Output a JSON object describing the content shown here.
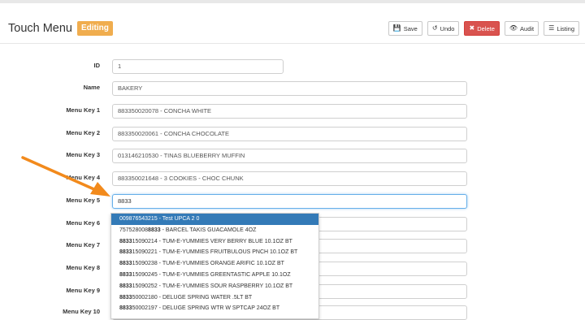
{
  "header": {
    "title": "Touch Menu",
    "badge": "Editing",
    "badge_color": "#f0ad4e"
  },
  "toolbar": {
    "save_label": "Save",
    "undo_label": "Undo",
    "delete_label": "Delete",
    "audit_label": "Audit",
    "listing_label": "Listing",
    "delete_color": "#d9534f",
    "icons": {
      "save": "floppy-icon",
      "undo": "undo-icon",
      "delete": "x-icon",
      "audit": "eye-icon",
      "listing": "list-icon"
    }
  },
  "form": {
    "id_label": "ID",
    "id_value": "1",
    "name_label": "Name",
    "name_value": "BAKERY",
    "menu_keys": [
      {
        "label": "Menu Key 1",
        "value": "883350020078 - CONCHA WHITE"
      },
      {
        "label": "Menu Key 2",
        "value": "883350020061 - CONCHA CHOCOLATE"
      },
      {
        "label": "Menu Key 3",
        "value": "013146210530 - TINAS BLUEBERRY MUFFIN"
      },
      {
        "label": "Menu Key 4",
        "value": "883350021648 - 3 COOKIES - CHOC CHUNK"
      },
      {
        "label": "Menu Key 5",
        "value": "8833"
      },
      {
        "label": "Menu Key 6",
        "value": ""
      },
      {
        "label": "Menu Key 7",
        "value": ""
      },
      {
        "label": "Menu Key 8",
        "value": ""
      },
      {
        "label": "Menu Key 9",
        "value": ""
      },
      {
        "label": "Menu Key 10",
        "value": ""
      }
    ]
  },
  "autocomplete": {
    "items": [
      {
        "pre": "009876543215 - Test UPCA 2 0",
        "match": "",
        "post": ""
      },
      {
        "pre": "757528008",
        "match": "8833",
        "post": " - BARCEL TAKIS GUACAMOLE 4OZ"
      },
      {
        "pre": "",
        "match": "8833",
        "post": "15090214 - TUM-E-YUMMIES VERY BERRY BLUE 10.1OZ BT"
      },
      {
        "pre": "",
        "match": "8833",
        "post": "15090221 - TUM-E-YUMMIES FRUITBULOUS PNCH 10.1OZ BT"
      },
      {
        "pre": "",
        "match": "8833",
        "post": "15090238 - TUM-E-YUMMIES ORANGE ARIFIC 10.1OZ BT"
      },
      {
        "pre": "",
        "match": "8833",
        "post": "15090245 - TUM-E-YUMMIES GREENTASTIC APPLE 10.1OZ"
      },
      {
        "pre": "",
        "match": "8833",
        "post": "15090252 - TUM-E-YUMMIES SOUR RASPBERRY 10.1OZ BT"
      },
      {
        "pre": "",
        "match": "8833",
        "post": "50002180 - DELUGE SPRING WATER .5LT BT"
      },
      {
        "pre": "",
        "match": "8833",
        "post": "50002197 - DELUGE SPRING WTR W SPTCAP 24OZ BT"
      }
    ],
    "highlight_color": "#337ab7"
  },
  "annotation": {
    "arrow_color": "#f28a1c"
  }
}
